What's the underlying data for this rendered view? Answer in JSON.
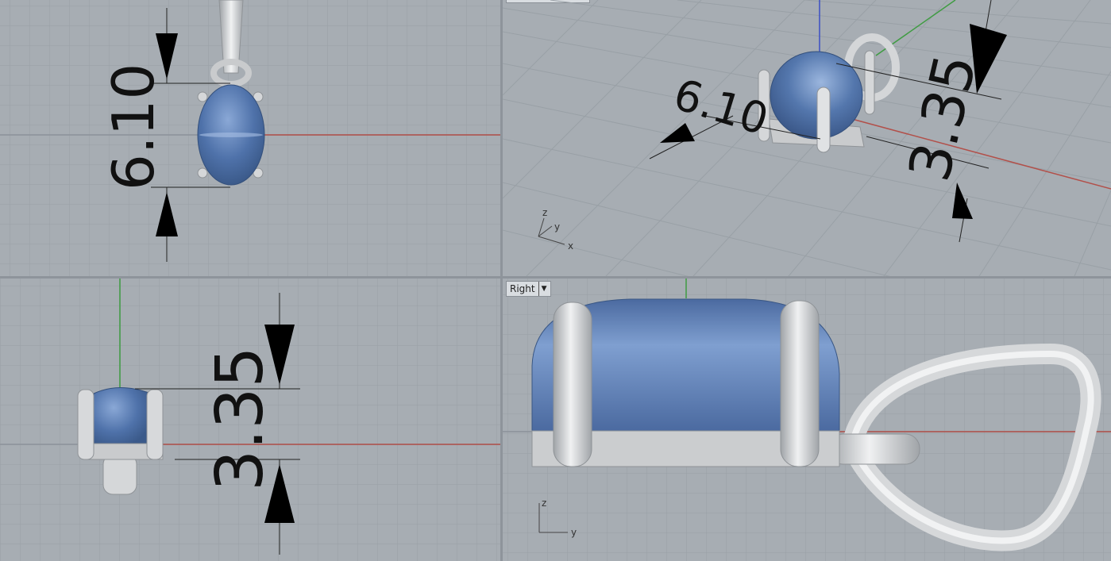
{
  "viewports": {
    "top": {
      "dimension": "6.10"
    },
    "perspective": {
      "dimension_width": "6.10",
      "dimension_height": "3.35",
      "axes": {
        "z": "z",
        "y": "y",
        "x": "x"
      }
    },
    "front": {
      "dimension": "3.35"
    },
    "right": {
      "tab_label": "Right",
      "axes": {
        "z": "z",
        "y": "y"
      }
    }
  },
  "colors": {
    "background": "#a7adb3",
    "gem": "#5d7fb3",
    "metal": "#d5d7d9",
    "x_axis": "#b2504a",
    "y_axis": "#3f9c42",
    "z_axis": "#3b4fc4"
  }
}
